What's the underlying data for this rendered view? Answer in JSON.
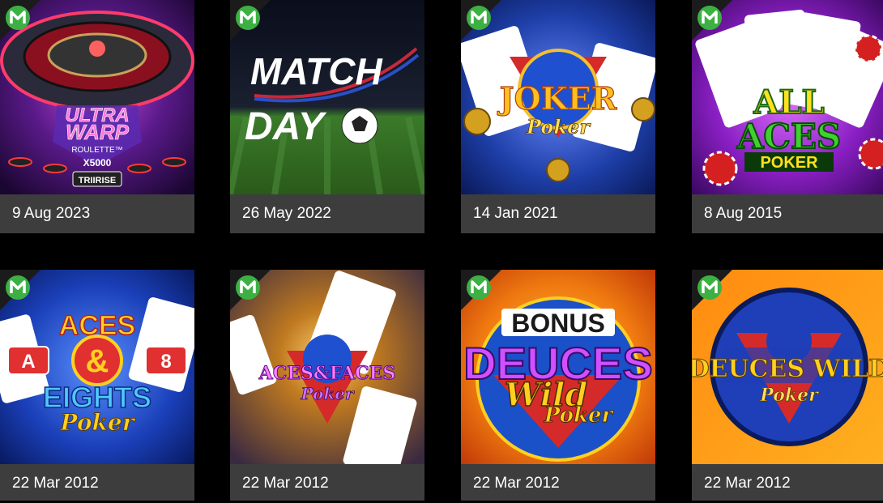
{
  "games": [
    {
      "date": "9 Aug 2023",
      "thumb_title": [
        "ULTRA",
        "WARP"
      ],
      "thumb_subtitle": [
        "ROULETTE™",
        "X5000",
        "TRIIRISE"
      ],
      "icon": "roulette-icon",
      "accent": "#7b2dbd"
    },
    {
      "date": "26 May 2022",
      "thumb_title": [
        "MATCH",
        "DAY"
      ],
      "thumb_subtitle": [],
      "icon": "soccer-ball-icon",
      "accent": "#2e7d1e"
    },
    {
      "date": "14 Jan 2021",
      "thumb_title": [
        "JOKER"
      ],
      "thumb_subtitle": [
        "Poker"
      ],
      "icon": "playing-cards-icon",
      "accent": "#1e3fa8"
    },
    {
      "date": "8 Aug 2015",
      "thumb_title": [
        "ALL",
        "ACES"
      ],
      "thumb_subtitle": [
        "POKER"
      ],
      "icon": "playing-cards-icon",
      "accent": "#8a1fc4"
    },
    {
      "date": "22 Mar 2012",
      "thumb_title": [
        "ACES",
        "&",
        "EIGHTS"
      ],
      "thumb_subtitle": [
        "A",
        "8",
        "Poker"
      ],
      "icon": "playing-cards-icon",
      "accent": "#1a3fb8"
    },
    {
      "date": "22 Mar 2012",
      "thumb_title": [
        "ACES & FACES"
      ],
      "thumb_subtitle": [
        "Poker"
      ],
      "icon": "playing-cards-icon",
      "accent": "#5a3a8a"
    },
    {
      "date": "22 Mar 2012",
      "thumb_title": [
        "BONUS",
        "DEUCES",
        "Wild"
      ],
      "thumb_subtitle": [
        "Poker"
      ],
      "icon": "playing-cards-icon",
      "accent": "#f07a10"
    },
    {
      "date": "22 Mar 2012",
      "thumb_title": [
        "DEUCES WILD"
      ],
      "thumb_subtitle": [
        "Poker"
      ],
      "icon": "playing-cards-icon",
      "accent": "#f59a10"
    }
  ],
  "provider_badge": {
    "icon": "microgaming-logo-icon",
    "color": "#3cb043"
  }
}
